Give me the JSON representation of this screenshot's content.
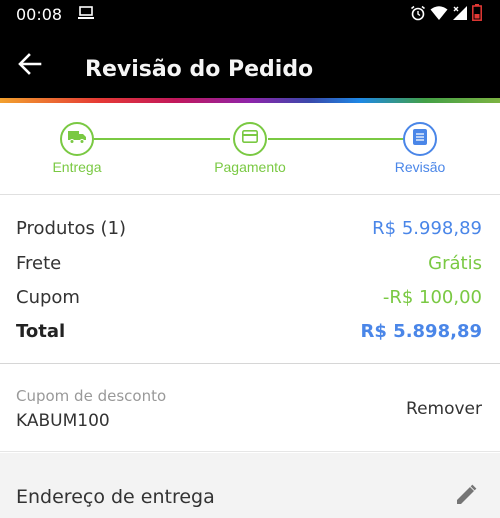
{
  "status_bar": {
    "time": "00:08"
  },
  "app_bar": {
    "title": "Revisão do Pedido"
  },
  "stepper": {
    "steps": [
      {
        "label": "Entrega",
        "icon": "truck-icon"
      },
      {
        "label": "Pagamento",
        "icon": "card-icon"
      },
      {
        "label": "Revisão",
        "icon": "list-icon"
      }
    ],
    "active_step": 3,
    "colors": {
      "done": "#7ac943",
      "active": "#4a86e8"
    }
  },
  "summary": {
    "products_label": "Produtos (1)",
    "products_value": "R$ 5.998,89",
    "shipping_label": "Frete",
    "shipping_value": "Grátis",
    "coupon_label": "Cupom",
    "coupon_value": "-R$ 100,00",
    "total_label": "Total",
    "total_value": "R$ 5.898,89"
  },
  "coupon": {
    "label": "Cupom de desconto",
    "code": "KABUM100",
    "remove_label": "Remover"
  },
  "address": {
    "title": "Endereço de entrega"
  }
}
